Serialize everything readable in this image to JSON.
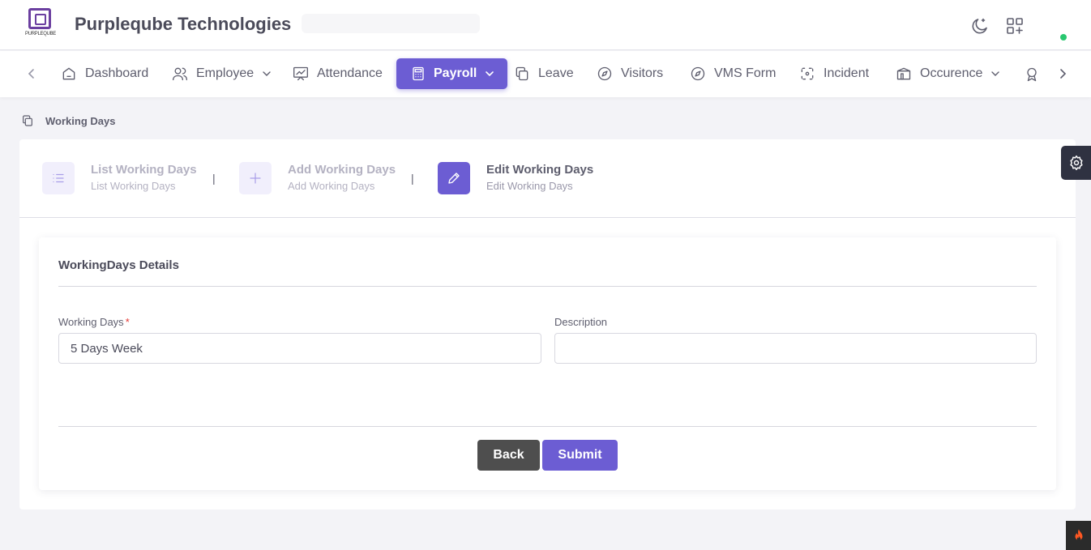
{
  "header": {
    "logo_text": "PURPLEQUBE",
    "company": "Purpleqube Technologies"
  },
  "nav": {
    "items": [
      {
        "label": "Dashboard"
      },
      {
        "label": "Employee"
      },
      {
        "label": "Attendance"
      },
      {
        "label": "Payroll"
      },
      {
        "label": "Leave"
      },
      {
        "label": "Visitors"
      },
      {
        "label": "VMS Form"
      },
      {
        "label": "Incident"
      },
      {
        "label": "Occurence"
      }
    ],
    "active": "Payroll"
  },
  "breadcrumb": {
    "label": "Working Days"
  },
  "steps": [
    {
      "title": "List Working Days",
      "subtitle": "List Working Days"
    },
    {
      "title": "Add Working Days",
      "subtitle": "Add Working Days"
    },
    {
      "title": "Edit Working Days",
      "subtitle": "Edit Working Days"
    }
  ],
  "step_separator": "|",
  "form": {
    "section_title": "WorkingDays Details",
    "working_days_label": "Working Days",
    "required_mark": "*",
    "working_days_value": "5 Days Week",
    "description_label": "Description",
    "description_value": ""
  },
  "buttons": {
    "back": "Back",
    "submit": "Submit"
  },
  "colors": {
    "accent": "#6c5dd3",
    "back_button": "#4e4e4e",
    "online": "#28c76f"
  }
}
